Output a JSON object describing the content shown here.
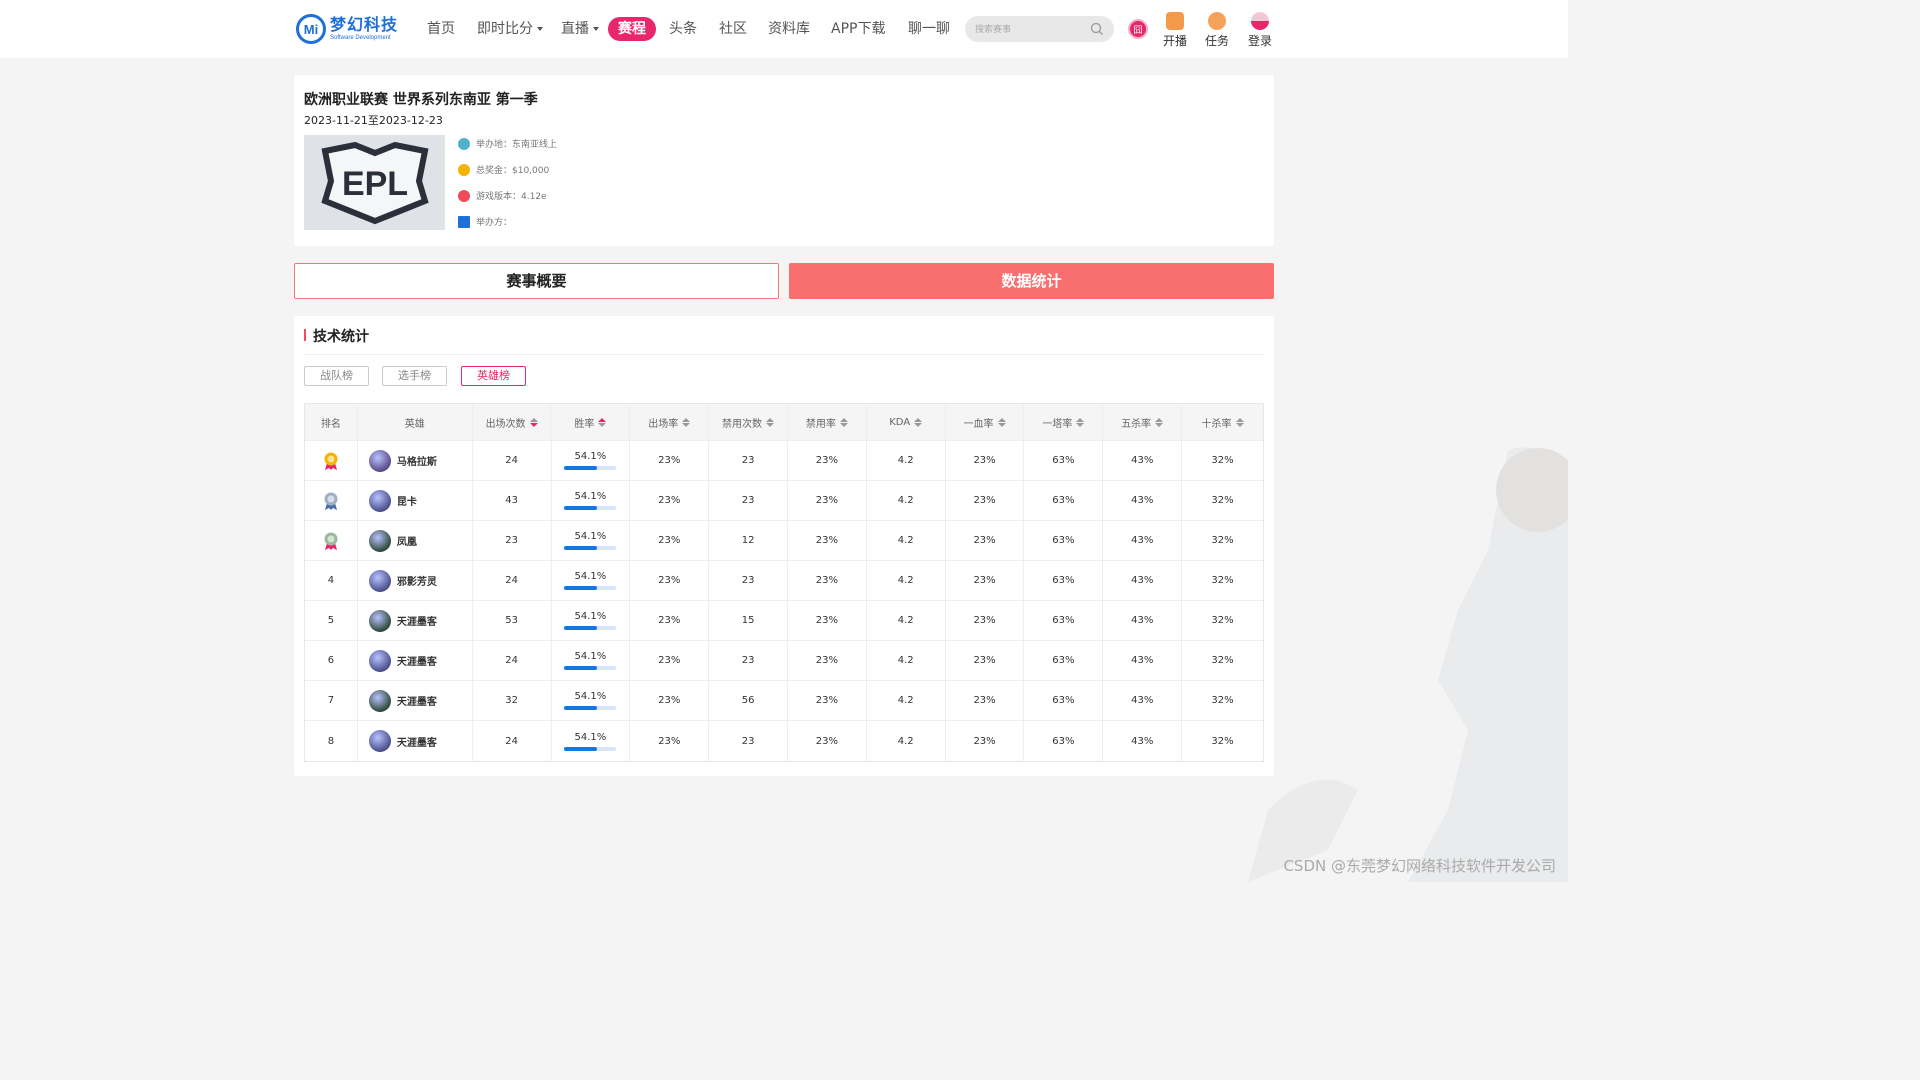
{
  "header": {
    "logo_cn": "梦幻科技",
    "logo_en": "Software Development",
    "logo_mark": "Mi",
    "nav": [
      {
        "label": "首页",
        "has_caret": false,
        "active": false
      },
      {
        "label": "即时比分",
        "has_caret": true,
        "active": false
      },
      {
        "label": "直播",
        "has_caret": true,
        "active": false
      },
      {
        "label": "赛程",
        "has_caret": false,
        "active": true
      },
      {
        "label": "头条",
        "has_caret": false,
        "active": false
      },
      {
        "label": "社区",
        "has_caret": false,
        "active": false
      },
      {
        "label": "资料库",
        "has_caret": false,
        "active": false
      },
      {
        "label": "APP下载",
        "has_caret": false,
        "active": false
      },
      {
        "label": "聊一聊",
        "has_caret": false,
        "active": false
      }
    ],
    "search_placeholder": "搜索赛事",
    "circle_badge": "囧",
    "actions": [
      {
        "label": "开播",
        "icon": "broadcast-icon",
        "color": "#f2994a"
      },
      {
        "label": "任务",
        "icon": "task-icon",
        "color": "#f5a35a"
      },
      {
        "label": "登录",
        "icon": "user-icon",
        "color": "#e8266b"
      }
    ]
  },
  "event": {
    "title": "欧洲职业联赛 世界系列东南亚 第一季",
    "date": "2023-11-21至2023-12-23",
    "logo_text": "EPL",
    "meta": [
      {
        "label": "举办地：东南亚线上",
        "icon": "location-icon",
        "color": "#4fb3c9"
      },
      {
        "label": "总奖金：$10,000",
        "icon": "money-bag-icon",
        "color": "#f5b400"
      },
      {
        "label": "游戏版本：4.12e",
        "icon": "version-icon",
        "color": "#f04b5a"
      },
      {
        "label": "举办方：",
        "icon": "building-icon",
        "color": "#1e6fd9"
      }
    ]
  },
  "tabs": {
    "overview": "赛事概要",
    "stats": "数据统计"
  },
  "stats": {
    "section_title": "技术统计",
    "chips": [
      {
        "label": "战队榜",
        "active": false
      },
      {
        "label": "选手榜",
        "active": false
      },
      {
        "label": "英雄榜",
        "active": true
      }
    ],
    "columns": [
      {
        "label": "排名",
        "sort": "none"
      },
      {
        "label": "英雄",
        "sort": "none"
      },
      {
        "label": "出场次数",
        "sort": "desc"
      },
      {
        "label": "胜率",
        "sort": "asc"
      },
      {
        "label": "出场率",
        "sort": "both"
      },
      {
        "label": "禁用次数",
        "sort": "both"
      },
      {
        "label": "禁用率",
        "sort": "both"
      },
      {
        "label": "KDA",
        "sort": "both"
      },
      {
        "label": "一血率",
        "sort": "both"
      },
      {
        "label": "一塔率",
        "sort": "both"
      },
      {
        "label": "五杀率",
        "sort": "both"
      },
      {
        "label": "十杀率",
        "sort": "both"
      }
    ],
    "rows": [
      {
        "rank": "1",
        "medal": "gold",
        "hero": "马格拉斯",
        "avatar": "#5b4a8a",
        "games": "24",
        "win_rate": "54.1%",
        "win_fraction": 0.62,
        "pick_rate": "23%",
        "bans": "23",
        "ban_rate": "23%",
        "kda": "4.2",
        "first_blood": "23%",
        "first_tower": "63%",
        "penta": "43%",
        "ten_kill": "32%"
      },
      {
        "rank": "2",
        "medal": "silver",
        "hero": "昆卡",
        "avatar": "#4a4f8a",
        "games": "43",
        "win_rate": "54.1%",
        "win_fraction": 0.62,
        "pick_rate": "23%",
        "bans": "23",
        "ban_rate": "23%",
        "kda": "4.2",
        "first_blood": "23%",
        "first_tower": "63%",
        "penta": "43%",
        "ten_kill": "32%"
      },
      {
        "rank": "3",
        "medal": "bronze",
        "hero": "凤凰",
        "avatar": "#2f4a3a",
        "games": "23",
        "win_rate": "54.1%",
        "win_fraction": 0.62,
        "pick_rate": "23%",
        "bans": "12",
        "ban_rate": "23%",
        "kda": "4.2",
        "first_blood": "23%",
        "first_tower": "63%",
        "penta": "43%",
        "ten_kill": "32%"
      },
      {
        "rank": "4",
        "medal": "",
        "hero": "邪影芳灵",
        "avatar": "#4a4f8a",
        "games": "24",
        "win_rate": "54.1%",
        "win_fraction": 0.62,
        "pick_rate": "23%",
        "bans": "23",
        "ban_rate": "23%",
        "kda": "4.2",
        "first_blood": "23%",
        "first_tower": "63%",
        "penta": "43%",
        "ten_kill": "32%"
      },
      {
        "rank": "5",
        "medal": "",
        "hero": "天涯墨客",
        "avatar": "#2f4a3a",
        "games": "53",
        "win_rate": "54.1%",
        "win_fraction": 0.62,
        "pick_rate": "23%",
        "bans": "15",
        "ban_rate": "23%",
        "kda": "4.2",
        "first_blood": "23%",
        "first_tower": "63%",
        "penta": "43%",
        "ten_kill": "32%"
      },
      {
        "rank": "6",
        "medal": "",
        "hero": "天涯墨客",
        "avatar": "#4a4f8a",
        "games": "24",
        "win_rate": "54.1%",
        "win_fraction": 0.62,
        "pick_rate": "23%",
        "bans": "23",
        "ban_rate": "23%",
        "kda": "4.2",
        "first_blood": "23%",
        "first_tower": "63%",
        "penta": "43%",
        "ten_kill": "32%"
      },
      {
        "rank": "7",
        "medal": "",
        "hero": "天涯墨客",
        "avatar": "#2f4a3a",
        "games": "32",
        "win_rate": "54.1%",
        "win_fraction": 0.62,
        "pick_rate": "23%",
        "bans": "56",
        "ban_rate": "23%",
        "kda": "4.2",
        "first_blood": "23%",
        "first_tower": "63%",
        "penta": "43%",
        "ten_kill": "32%"
      },
      {
        "rank": "8",
        "medal": "",
        "hero": "天涯墨客",
        "avatar": "#4a4f8a",
        "games": "24",
        "win_rate": "54.1%",
        "win_fraction": 0.62,
        "pick_rate": "23%",
        "bans": "23",
        "ban_rate": "23%",
        "kda": "4.2",
        "first_blood": "23%",
        "first_tower": "63%",
        "penta": "43%",
        "ten_kill": "32%"
      }
    ]
  },
  "watermark": "CSDN @东莞梦幻网络科技软件开发公司",
  "colors": {
    "brand": "#1e6fd9",
    "accent": "#e8266b",
    "stats_tab": "#f96e6e",
    "bar_fill": "#1677e0"
  }
}
